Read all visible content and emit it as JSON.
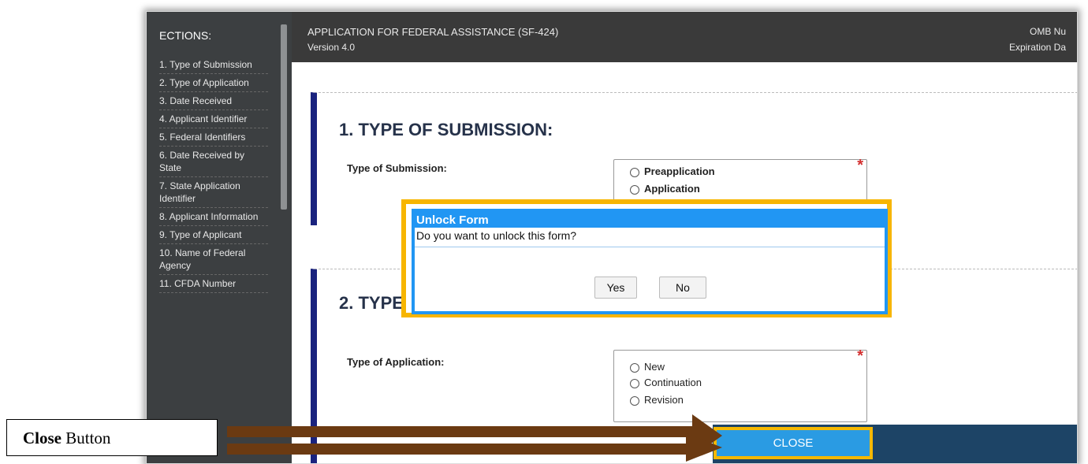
{
  "sidebar": {
    "title": "ECTIONS:",
    "items": [
      "1. Type of Submission",
      "2. Type of Application",
      "3. Date Received",
      "4. Applicant Identifier",
      "5. Federal Identifiers",
      "6. Date Received by State",
      "7. State Application Identifier",
      "8. Applicant Information",
      "9. Type of Applicant",
      "10. Name of Federal Agency",
      "11. CFDA Number"
    ]
  },
  "header": {
    "title": "APPLICATION FOR FEDERAL ASSISTANCE (SF-424)",
    "version": "Version 4.0",
    "omb": "OMB Nu",
    "expiration": "Expiration Da"
  },
  "section1": {
    "heading": "1. TYPE OF SUBMISSION:",
    "field_label": "Type of Submission:",
    "options": [
      "Preapplication",
      "Application"
    ]
  },
  "section2": {
    "heading": "2. TYPE",
    "field_label": "Type of Application:",
    "options": [
      "New",
      "Continuation",
      "Revision"
    ]
  },
  "required_marker": "*",
  "modal": {
    "title": "Unlock Form",
    "message": "Do you want to unlock this form?",
    "yes_label": "Yes",
    "no_label": "No"
  },
  "close_button": {
    "label": "CLOSE"
  },
  "callout": {
    "bold": "Close",
    "rest": " Button"
  },
  "colors": {
    "sidebar_bg": "#3c3f41",
    "header_bg": "#3a3a3a",
    "accent_blue": "#2196f3",
    "highlight_yellow": "#f7b500",
    "arrow_brown": "#6b3a12",
    "card_border": "#1a237e"
  }
}
